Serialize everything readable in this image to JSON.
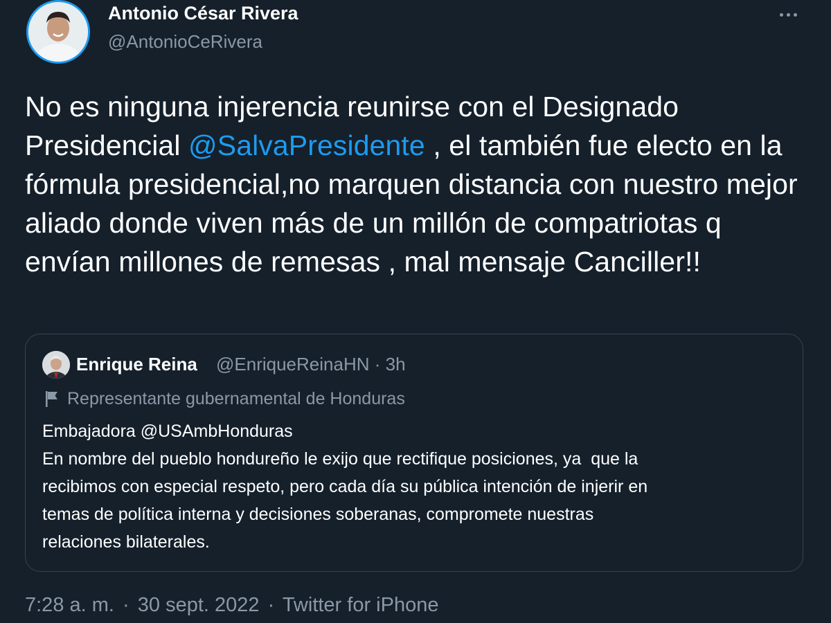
{
  "author": {
    "name": "Antonio César Rivera",
    "handle": "@AntonioCeRivera"
  },
  "tweet": {
    "text_before": "No es ninguna injerencia reunirse con el Designado Presidencial ",
    "mention": "@SalvaPresidente",
    "text_after": " , el también fue electo en la fórmula presidencial,no marquen distancia con nuestro mejor aliado donde viven más de un millón de compatriotas q envían millones de remesas , mal mensaje Canciller!!"
  },
  "quoted": {
    "name": "Enrique Reina",
    "handle": "@EnriqueReinaHN",
    "separator": "·",
    "time": "3h",
    "label": "Representante gubernamental de Honduras",
    "lines": [
      "Embajadora @USAmbHonduras",
      "En nombre del pueblo hondureño le exijo que rectifique posiciones, ya  que la",
      "recibimos con especial respeto, pero cada día su pública intención de injerir en",
      "temas de política interna y decisiones soberanas, compromete nuestras",
      "relaciones bilaterales."
    ]
  },
  "footer": {
    "time": "7:28 a. m.",
    "separator": "·",
    "date": "30 sept. 2022",
    "source": "Twitter for iPhone"
  },
  "colors": {
    "background": "#15202b",
    "text": "#ffffff",
    "secondary": "#8b98a5",
    "accent": "#1d9bf0",
    "border": "#38444d"
  },
  "icons": [
    "more-options-icon",
    "government-flag-icon"
  ]
}
